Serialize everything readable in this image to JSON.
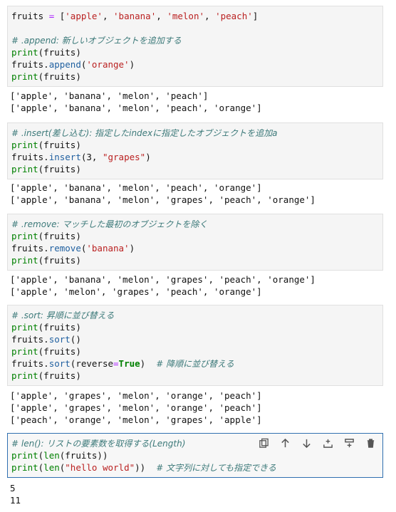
{
  "cells": [
    {
      "code": [
        "fruits = ['apple', 'banana', 'melon', 'peach']"
      ],
      "output": []
    },
    {
      "comment": "# .append: 新しいオブジェクトを追加する",
      "print": "print",
      "fruits": "fruits",
      "method": "append",
      "arg": "'orange'",
      "output": [
        "['apple', 'banana', 'melon', 'peach']",
        "['apple', 'banana', 'melon', 'peach', 'orange']"
      ]
    },
    {
      "comment": "# .insert(差し込む): 指定したindexに指定したオブジェクトを追加a",
      "method": "insert",
      "arg_num": "3",
      "arg": "\"grapes\"",
      "output": [
        "['apple', 'banana', 'melon', 'peach', 'orange']",
        "['apple', 'banana', 'melon', 'grapes', 'peach', 'orange']"
      ]
    },
    {
      "comment": "# .remove: マッチした最初のオブジェクトを除く",
      "method": "remove",
      "arg": "'banana'",
      "output": [
        "['apple', 'banana', 'melon', 'grapes', 'peach', 'orange']",
        "['apple', 'melon', 'grapes', 'peach', 'orange']"
      ]
    },
    {
      "comment": "# .sort: 昇順に並び替える",
      "method": "sort",
      "kwarg": "reverse",
      "kwval": "True",
      "inline_comment": "# 降順に並び替える",
      "output": [
        "['apple', 'grapes', 'melon', 'orange', 'peach']",
        "['apple', 'grapes', 'melon', 'orange', 'peach']",
        "['peach', 'orange', 'melon', 'grapes', 'apple']"
      ]
    },
    {
      "comment": "# len(): リストの要素数を取得する(Length)",
      "fn_len": "len",
      "arg": "\"hello world\"",
      "inline_comment": "# 文字列に対しても指定できる",
      "output": [
        "5",
        "11"
      ]
    }
  ],
  "toolbar": {
    "icons": [
      "duplicate-icon",
      "arrow-up-icon",
      "arrow-down-icon",
      "insert-above-icon",
      "insert-below-icon",
      "trash-icon"
    ]
  }
}
